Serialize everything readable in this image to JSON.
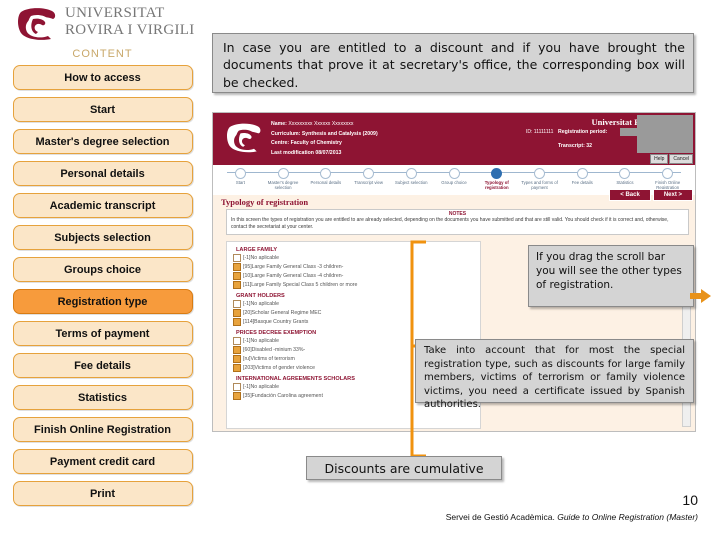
{
  "logo": {
    "line1": "UNIVERSITAT",
    "line2": "ROVIRA I VIRGILI",
    "icon": "urv-crest-icon"
  },
  "sidebar": {
    "title": "CONTENT",
    "items": [
      {
        "label": "How to access",
        "active": false
      },
      {
        "label": "Start",
        "active": false
      },
      {
        "label": "Master's degree selection",
        "active": false
      },
      {
        "label": "Personal details",
        "active": false
      },
      {
        "label": "Academic transcript",
        "active": false
      },
      {
        "label": "Subjects selection",
        "active": false
      },
      {
        "label": "Groups choice",
        "active": false
      },
      {
        "label": "Registration type",
        "active": true
      },
      {
        "label": "Terms of payment",
        "active": false
      },
      {
        "label": "Fee details",
        "active": false
      },
      {
        "label": "Statistics",
        "active": false
      },
      {
        "label": "Finish Online Registration",
        "active": false
      },
      {
        "label": "Payment credit card",
        "active": false
      },
      {
        "label": "Print",
        "active": false
      }
    ]
  },
  "callouts": {
    "top": "In case you are entitled to a discount and if you have brought the documents that prove it at secretary's office, the corresponding box will be checked.",
    "scroll": "If you drag the scroll bar  you will see the other types of registration.",
    "certificate": "Take into account that for most the special registration type, such as discounts for large family members, victims of terrorism or family violence victims, you need a certificate issued by Spanish authorities.",
    "cumulative": "Discounts are cumulative"
  },
  "screenshot": {
    "university": "Universitat Rovira i Virgili",
    "student": {
      "name_label": "Name:",
      "name_value": "Xxxxxxxxx Xxxxxx Xxxxxxxx",
      "curriculum": "Curriculum: Synthesis and Catalysis (2009)",
      "centre": "Centre: Faculty of Chemistry",
      "last_modification": "Last modification 08/07/2013"
    },
    "id_label": "ID: 11111111",
    "registration_period_label": "Registration period:",
    "transcript_label": "Transcript: 32",
    "help_label": "Help",
    "cancel_label": "Cancel",
    "steps": [
      {
        "label": "Start",
        "active": false
      },
      {
        "label": "Master's degree selection",
        "active": false
      },
      {
        "label": "Personal details",
        "active": false
      },
      {
        "label": "Transcript view",
        "active": false
      },
      {
        "label": "Subject selection",
        "active": false
      },
      {
        "label": "Group choice",
        "active": false
      },
      {
        "label": "Typology of registration",
        "active": true
      },
      {
        "label": "Types and forms of payment",
        "active": false
      },
      {
        "label": "Fee details",
        "active": false
      },
      {
        "label": "Statistics",
        "active": false
      },
      {
        "label": "Finish Online Registration",
        "active": false
      }
    ],
    "back_label": "< Back",
    "next_label": "Next >",
    "page_title": "Typology of registration",
    "notes_title": "NOTES",
    "notes_text": "In this screen the types of registration you are entitled to are already selected, depending on the documents you have submitted and that are still valid. You should check if it is correct and, otherwise, contact the secretariat at your center.",
    "groups": [
      {
        "title": "LARGE FAMILY",
        "options": [
          {
            "label": "[-1]No aplicable",
            "selected": false
          },
          {
            "label": "[95]Large Family General Class -3 children-",
            "selected": true
          },
          {
            "label": "[10]Large Family General Class -4 children-",
            "selected": true
          },
          {
            "label": "[11]Large Family Special Class  5 children  or more",
            "selected": true
          }
        ]
      },
      {
        "title": "GRANT HOLDERS",
        "options": [
          {
            "label": "[-1]No aplicable",
            "selected": false
          },
          {
            "label": "[20]Scholar General Regime MEC",
            "selected": true
          },
          {
            "label": "[114]Basque Country Grants",
            "selected": true
          }
        ]
      },
      {
        "title": "PRICES DECREE EXEMPTION",
        "options": [
          {
            "label": "[-1]No aplicable",
            "selected": false
          },
          {
            "label": "[60]Disabled -minium 33%-",
            "selected": true
          },
          {
            "label": "[ru]Victims of terrorism",
            "selected": true
          },
          {
            "label": "[203]Victims of gender violence",
            "selected": true
          }
        ]
      },
      {
        "title": "INTERNATIONAL AGREEMENTS SCHOLARS",
        "options": [
          {
            "label": "[-1]No aplicable",
            "selected": false
          },
          {
            "label": "[35]Fundación Carolina agreement",
            "selected": true
          }
        ]
      }
    ]
  },
  "footer": {
    "page_number": "10",
    "note_plain": "Servei de Gestió Acadèmica. ",
    "note_italic": "Guide to Online Registration (Master)"
  },
  "colors": {
    "brand_maroon": "#8e1433",
    "accent_orange": "#f79b3c",
    "nav_fill": "#fbe6c8",
    "callout_gray": "#d4d4d4"
  }
}
